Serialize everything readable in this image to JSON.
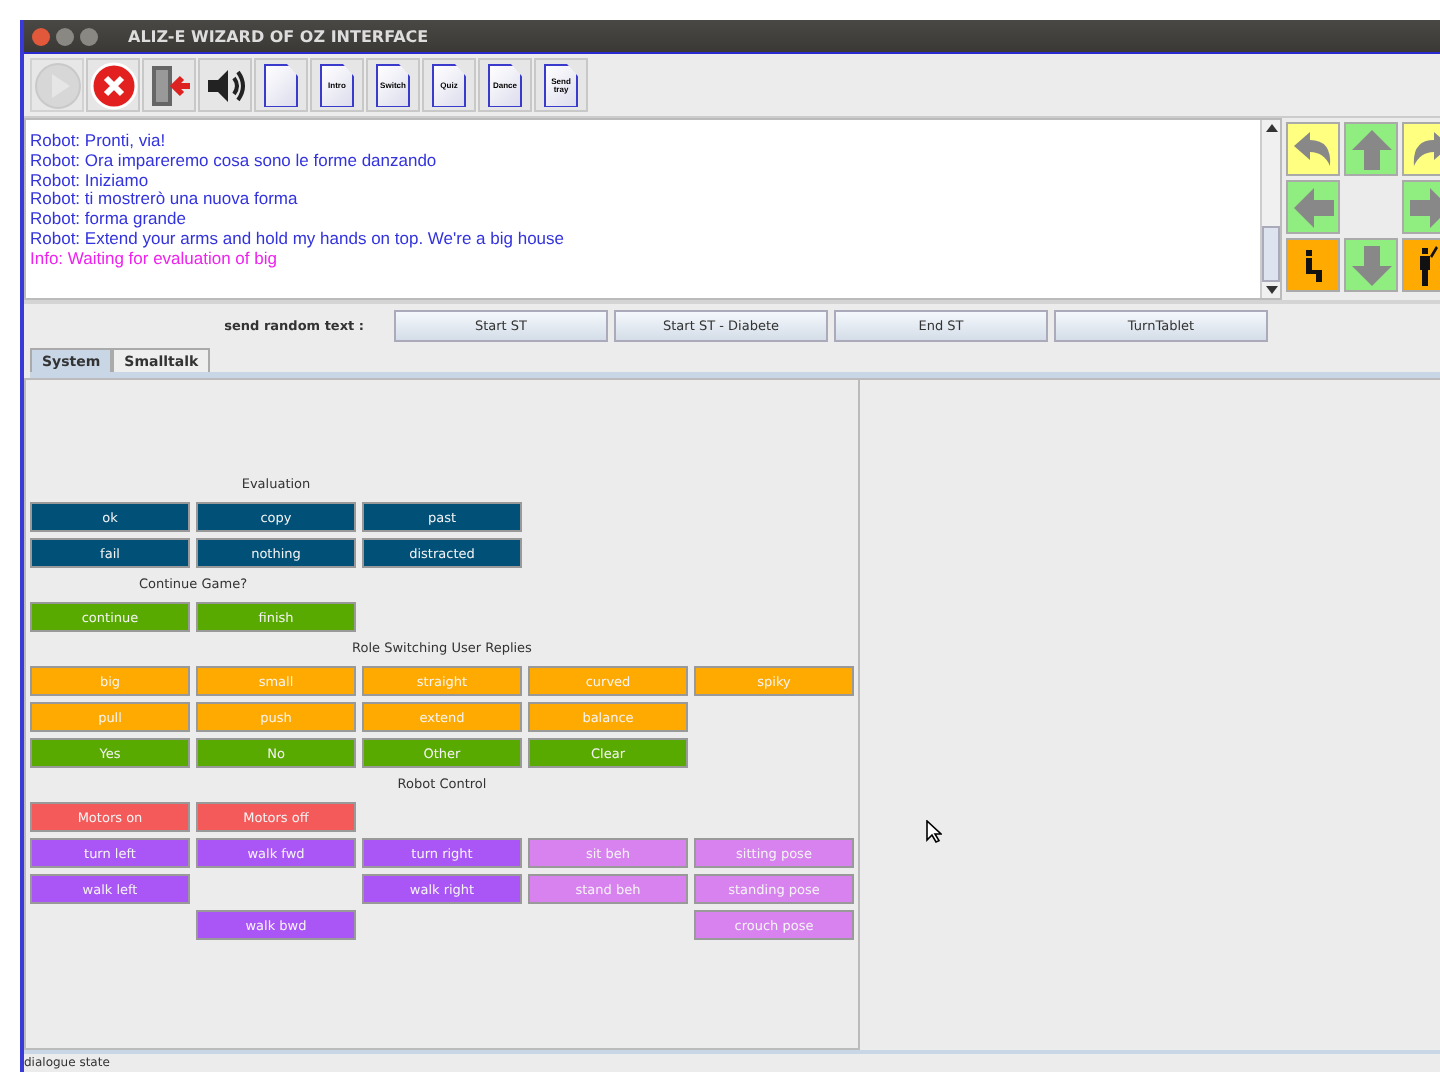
{
  "window": {
    "title": "ALIZ-E WIZARD OF OZ INTERFACE"
  },
  "toolbar": [
    {
      "kind": "play",
      "disabled": true
    },
    {
      "kind": "stop",
      "disabled": false
    },
    {
      "kind": "exit",
      "disabled": false
    },
    {
      "kind": "sound",
      "disabled": false
    },
    {
      "kind": "doc",
      "disabled": false
    },
    {
      "kind": "doc",
      "label": "Intro",
      "disabled": false
    },
    {
      "kind": "doc",
      "label": "Switch",
      "disabled": false
    },
    {
      "kind": "doc",
      "label": "Quiz",
      "disabled": false
    },
    {
      "kind": "doc",
      "label": "Dance",
      "disabled": false
    },
    {
      "kind": "doc",
      "label": "Send tray",
      "disabled": false
    }
  ],
  "log": [
    {
      "kind": "robot",
      "text": "Robot: Pronti, via!"
    },
    {
      "kind": "robot",
      "text": "Robot: Ora impareremo cosa sono le forme danzando"
    },
    {
      "kind": "robot",
      "text": "Robot: Iniziamo"
    },
    {
      "kind": "robot",
      "text": "Robot: ti mostrerò una nuova forma"
    },
    {
      "kind": "robot",
      "text": "Robot: forma grande"
    },
    {
      "kind": "robot",
      "text": "Robot: Extend your arms and hold my hands on top. We're a big house"
    },
    {
      "kind": "info",
      "text": "Info: Waiting for evaluation of big"
    }
  ],
  "pad": [
    {
      "kind": "turn-left",
      "color": "#ffff80"
    },
    {
      "kind": "up",
      "color": "#90ee80"
    },
    {
      "kind": "turn-right",
      "color": "#ffff80"
    },
    {
      "kind": "left",
      "color": "#90ee80"
    },
    {
      "kind": "empty"
    },
    {
      "kind": "right",
      "color": "#90ee80"
    },
    {
      "kind": "sit",
      "color": "#ffaa00"
    },
    {
      "kind": "down",
      "color": "#90ee80"
    },
    {
      "kind": "stand",
      "color": "#ffaa00"
    }
  ],
  "random_text": {
    "label": "send random text :",
    "buttons": [
      "Start ST",
      "Start ST - Diabete",
      "End ST",
      "TurnTablet"
    ]
  },
  "tabs": [
    {
      "label": "System",
      "selected": true
    },
    {
      "label": "Smalltalk",
      "selected": false
    }
  ],
  "sections": [
    {
      "heading": "Evaluation",
      "rows": [
        [
          {
            "label": "ok",
            "color": "#005078"
          },
          {
            "label": "copy",
            "color": "#005078"
          },
          {
            "label": "past",
            "color": "#005078"
          }
        ],
        [
          {
            "label": "fail",
            "color": "#005078"
          },
          {
            "label": "nothing",
            "color": "#005078"
          },
          {
            "label": "distracted",
            "color": "#005078"
          }
        ]
      ]
    },
    {
      "heading": "Continue Game?",
      "rows": [
        [
          {
            "label": "continue",
            "color": "#58aa00"
          },
          {
            "label": "finish",
            "color": "#58aa00"
          }
        ]
      ]
    },
    {
      "heading": "Role Switching User Replies",
      "rows": [
        [
          {
            "label": "big",
            "color": "#ffaa00"
          },
          {
            "label": "small",
            "color": "#ffaa00"
          },
          {
            "label": "straight",
            "color": "#ffaa00"
          },
          {
            "label": "curved",
            "color": "#ffaa00"
          },
          {
            "label": "spiky",
            "color": "#ffaa00"
          }
        ],
        [
          {
            "label": "pull",
            "color": "#ffaa00"
          },
          {
            "label": "push",
            "color": "#ffaa00"
          },
          {
            "label": "extend",
            "color": "#ffaa00"
          },
          {
            "label": "balance",
            "color": "#ffaa00"
          }
        ],
        [
          {
            "label": "Yes",
            "color": "#58aa00"
          },
          {
            "label": "No",
            "color": "#58aa00"
          },
          {
            "label": "Other",
            "color": "#58aa00"
          },
          {
            "label": "Clear",
            "color": "#58aa00"
          }
        ]
      ]
    },
    {
      "heading": "Robot Control",
      "rows": [
        [
          {
            "label": "Motors on",
            "color": "#f45a5a"
          },
          {
            "label": "Motors off",
            "color": "#f45a5a"
          }
        ],
        [
          {
            "label": "turn left",
            "color": "#aa55f5"
          },
          {
            "label": "walk fwd",
            "color": "#aa55f5"
          },
          {
            "label": "turn right",
            "color": "#aa55f5"
          },
          {
            "label": "sit beh",
            "color": "#d882f0"
          },
          {
            "label": "sitting pose",
            "color": "#d882f0"
          }
        ],
        [
          {
            "label": "walk left",
            "color": "#aa55f5"
          },
          {
            "kind": "gap"
          },
          {
            "label": "walk right",
            "color": "#aa55f5"
          },
          {
            "label": "stand beh",
            "color": "#d882f0"
          },
          {
            "label": "standing pose",
            "color": "#d882f0"
          }
        ],
        [
          {
            "kind": "gap"
          },
          {
            "label": "walk bwd",
            "color": "#aa55f5"
          },
          {
            "kind": "gap"
          },
          {
            "kind": "gap"
          },
          {
            "label": "crouch pose",
            "color": "#d882f0"
          }
        ]
      ]
    }
  ],
  "status_bar": "dialogue state"
}
